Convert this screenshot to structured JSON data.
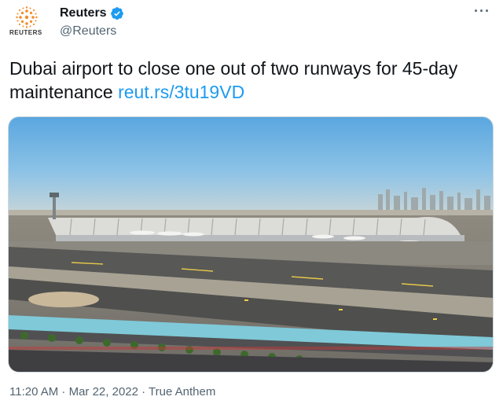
{
  "account": {
    "display_name": "Reuters",
    "handle": "@Reuters",
    "logo_word": "REUTERS",
    "avatar_icon": "reuters-dot-logo-icon",
    "verified_icon": "verified-badge-icon",
    "more_icon": "more-dots-icon"
  },
  "tweet": {
    "text": "Dubai airport to close one out of two runways for 45-day maintenance",
    "link": "reut.rs/3tu19VD"
  },
  "media": {
    "type": "photo",
    "scene_label": "aerial view of Dubai airport terminal and runways"
  },
  "meta": {
    "timestamp": "11:20 AM · Mar 22, 2022 · True Anthem"
  },
  "colors": {
    "link": "#1d9bf0",
    "secondary_text": "#536471",
    "reuters_orange": "#f28c28",
    "verified_blue": "#1d9bf0"
  }
}
